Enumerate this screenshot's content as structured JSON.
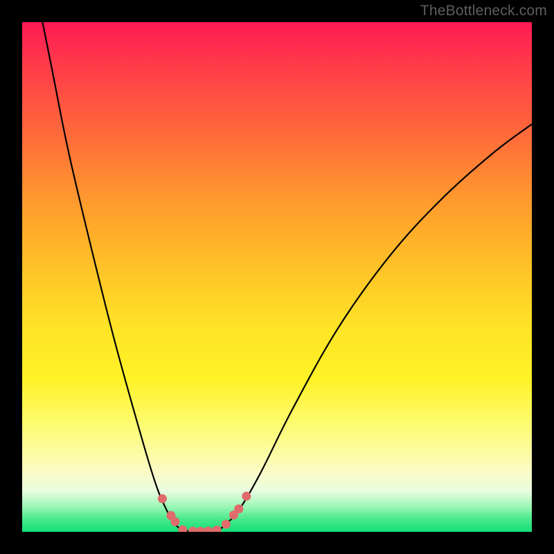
{
  "watermark": "TheBottleneck.com",
  "colors": {
    "frame": "#000000",
    "curve_stroke": "#000000",
    "marker_fill": "#e06b6b",
    "marker_stroke": "#c74f4f",
    "gradient_top": "#ff1a54",
    "gradient_bottom": "#11df79"
  },
  "chart_data": {
    "type": "line",
    "title": "",
    "xlabel": "",
    "ylabel": "",
    "xlim": [
      0,
      100
    ],
    "ylim": [
      0,
      100
    ],
    "curve": [
      {
        "x": 4,
        "y": 100
      },
      {
        "x": 6,
        "y": 90
      },
      {
        "x": 9,
        "y": 75
      },
      {
        "x": 13,
        "y": 58
      },
      {
        "x": 18,
        "y": 38
      },
      {
        "x": 23,
        "y": 20
      },
      {
        "x": 26,
        "y": 10
      },
      {
        "x": 28,
        "y": 5
      },
      {
        "x": 30,
        "y": 1.5
      },
      {
        "x": 32,
        "y": 0.3
      },
      {
        "x": 35,
        "y": 0.0
      },
      {
        "x": 38,
        "y": 0.3
      },
      {
        "x": 40,
        "y": 1.5
      },
      {
        "x": 43,
        "y": 5
      },
      {
        "x": 47,
        "y": 12
      },
      {
        "x": 53,
        "y": 24
      },
      {
        "x": 62,
        "y": 40
      },
      {
        "x": 72,
        "y": 54
      },
      {
        "x": 82,
        "y": 65
      },
      {
        "x": 92,
        "y": 74
      },
      {
        "x": 100,
        "y": 80
      }
    ],
    "markers": [
      {
        "x": 27.5,
        "y": 6.5
      },
      {
        "x": 29.2,
        "y": 3.2
      },
      {
        "x": 30.0,
        "y": 2.0
      },
      {
        "x": 31.5,
        "y": 0.4
      },
      {
        "x": 33.5,
        "y": 0.15
      },
      {
        "x": 35.0,
        "y": 0.1
      },
      {
        "x": 36.5,
        "y": 0.15
      },
      {
        "x": 38.2,
        "y": 0.35
      },
      {
        "x": 40.0,
        "y": 1.5
      },
      {
        "x": 41.5,
        "y": 3.3
      },
      {
        "x": 42.5,
        "y": 4.5
      },
      {
        "x": 44.0,
        "y": 7.0
      }
    ]
  }
}
